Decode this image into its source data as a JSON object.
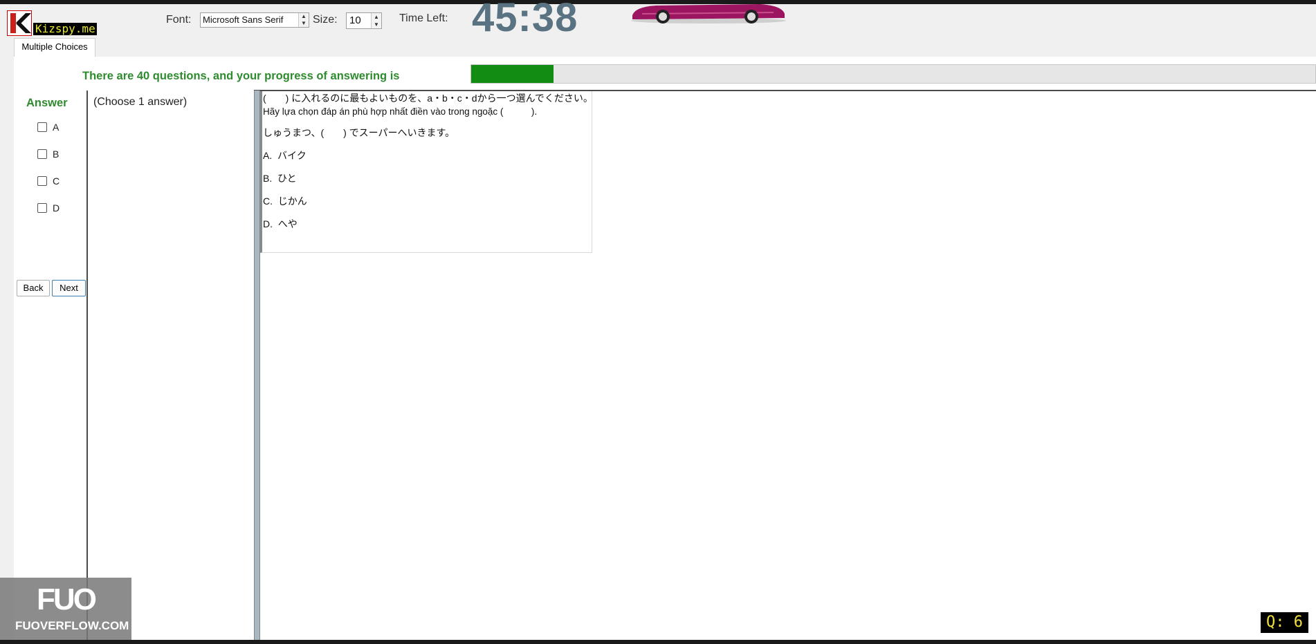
{
  "app": {
    "logo_letter": "K",
    "logo_text": "Kizspy.me",
    "tab_label": "Multiple Choices"
  },
  "toolbar": {
    "font_label": "Font:",
    "font_value": "Microsoft Sans Serif",
    "size_label": "Size:",
    "size_value": "10",
    "time_left_label": "Time Left:",
    "timer_value": "45:38"
  },
  "progress": {
    "text": "There are 40 questions, and your progress of answering is",
    "fraction": 0.0975,
    "fill_color": "#138c13"
  },
  "answer_panel": {
    "title": "Answer",
    "options": [
      "A",
      "B",
      "C",
      "D"
    ],
    "back_label": "Back",
    "next_label": "Next"
  },
  "instruction": {
    "choose_text": "(Choose 1 answer)"
  },
  "question": {
    "line1": "(　　) に入れるのに最もよいものを、a・b・c・dから一つ選んでください。",
    "line2": "Hãy lựa chọn đáp án phù hợp nhất điền vào trong ngoặc (　　　).",
    "sentence": "しゅうまつ、(　　) でスーパーへいきます。",
    "choices": [
      {
        "letter": "A.",
        "text": "バイク"
      },
      {
        "letter": "B.",
        "text": "ひと"
      },
      {
        "letter": "C.",
        "text": "じかん"
      },
      {
        "letter": "D.",
        "text": "へや"
      }
    ]
  },
  "watermark": {
    "logo": "FUO",
    "text": "FUOVERFLOW.COM"
  },
  "question_badge": "Q: 6",
  "colors": {
    "accent_green": "#2e8b2e",
    "timer": "#5a7382"
  }
}
